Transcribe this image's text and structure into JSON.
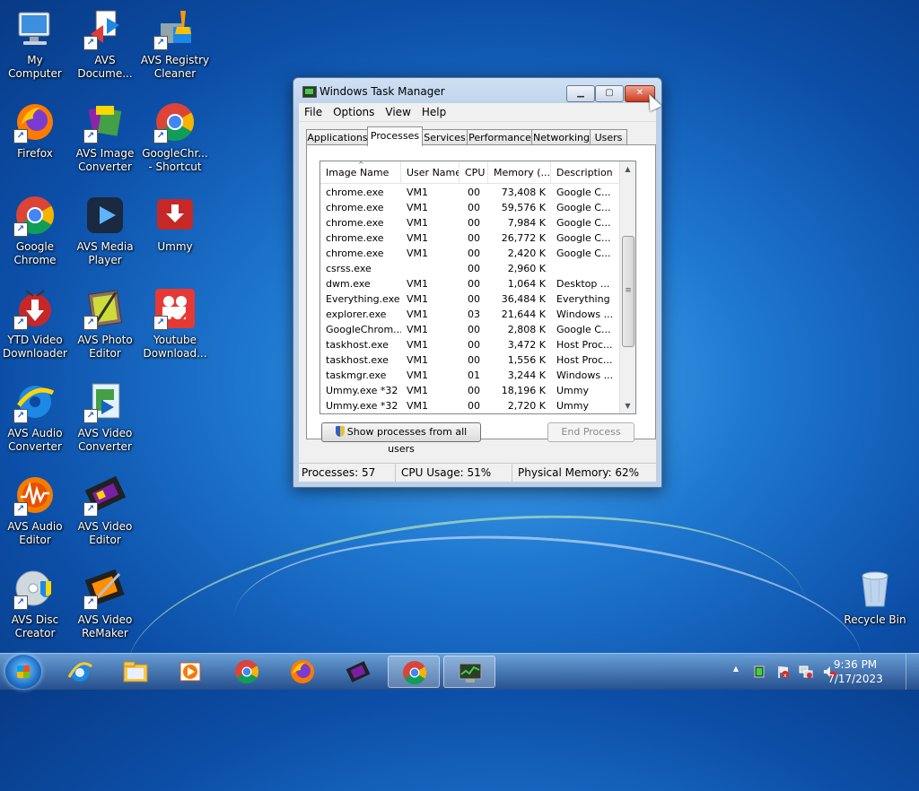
{
  "desktop": {
    "icons": [
      {
        "label": "My Computer",
        "icon": "computer-icon"
      },
      {
        "label": "AVS Docume...",
        "icon": "avs-document-converter-icon"
      },
      {
        "label": "AVS Registry Cleaner",
        "icon": "avs-registry-cleaner-icon"
      },
      {
        "label": "Firefox",
        "icon": "firefox-icon"
      },
      {
        "label": "AVS Image Converter",
        "icon": "avs-image-converter-icon"
      },
      {
        "label": "GoogleChr... - Shortcut",
        "icon": "chrome-icon"
      },
      {
        "label": "Google Chrome",
        "icon": "chrome-icon"
      },
      {
        "label": "AVS Media Player",
        "icon": "avs-media-player-icon"
      },
      {
        "label": "Ummy",
        "icon": "ummy-icon"
      },
      {
        "label": "YTD Video Downloader",
        "icon": "ytd-downloader-icon"
      },
      {
        "label": "AVS Photo Editor",
        "icon": "avs-photo-editor-icon"
      },
      {
        "label": "Youtube Download...",
        "icon": "youtube-downloader-icon"
      },
      {
        "label": "AVS Audio Converter",
        "icon": "avs-audio-converter-icon"
      },
      {
        "label": "AVS Video Converter",
        "icon": "avs-video-converter-icon"
      },
      {
        "label": "AVS Audio Editor",
        "icon": "avs-audio-editor-icon"
      },
      {
        "label": "AVS Video Editor",
        "icon": "avs-video-editor-icon"
      },
      {
        "label": "AVS Disc Creator",
        "icon": "avs-disc-creator-icon"
      },
      {
        "label": "AVS Video ReMaker",
        "icon": "avs-video-remaker-icon"
      },
      {
        "label": "Recycle Bin",
        "icon": "recycle-bin-icon"
      }
    ]
  },
  "window": {
    "title": "Windows Task Manager",
    "minimize_glyph": "▁",
    "maximize_glyph": "▢",
    "close_glyph": "✕",
    "menu": [
      "File",
      "Options",
      "View",
      "Help"
    ],
    "tabs": [
      "Applications",
      "Processes",
      "Services",
      "Performance",
      "Networking",
      "Users"
    ],
    "active_tab": "Processes",
    "columns": [
      "Image Name",
      "User Name",
      "CPU",
      "Memory (...",
      "Description"
    ],
    "sort_glyph": "^",
    "processes": [
      {
        "name": "chrome.exe",
        "user": "VM1",
        "cpu": "00",
        "memory": "73,408 K",
        "desc": "Google C..."
      },
      {
        "name": "chrome.exe",
        "user": "VM1",
        "cpu": "00",
        "memory": "59,576 K",
        "desc": "Google C..."
      },
      {
        "name": "chrome.exe",
        "user": "VM1",
        "cpu": "00",
        "memory": "7,984 K",
        "desc": "Google C..."
      },
      {
        "name": "chrome.exe",
        "user": "VM1",
        "cpu": "00",
        "memory": "26,772 K",
        "desc": "Google C..."
      },
      {
        "name": "chrome.exe",
        "user": "VM1",
        "cpu": "00",
        "memory": "2,420 K",
        "desc": "Google C..."
      },
      {
        "name": "csrss.exe",
        "user": "",
        "cpu": "00",
        "memory": "2,960 K",
        "desc": ""
      },
      {
        "name": "dwm.exe",
        "user": "VM1",
        "cpu": "00",
        "memory": "1,064 K",
        "desc": "Desktop ..."
      },
      {
        "name": "Everything.exe",
        "user": "VM1",
        "cpu": "00",
        "memory": "36,484 K",
        "desc": "Everything"
      },
      {
        "name": "explorer.exe",
        "user": "VM1",
        "cpu": "03",
        "memory": "21,644 K",
        "desc": "Windows ..."
      },
      {
        "name": "GoogleChrom...",
        "user": "VM1",
        "cpu": "00",
        "memory": "2,808 K",
        "desc": "Google C..."
      },
      {
        "name": "taskhost.exe",
        "user": "VM1",
        "cpu": "00",
        "memory": "3,472 K",
        "desc": "Host Proc..."
      },
      {
        "name": "taskhost.exe",
        "user": "VM1",
        "cpu": "00",
        "memory": "1,556 K",
        "desc": "Host Proc..."
      },
      {
        "name": "taskmgr.exe",
        "user": "VM1",
        "cpu": "01",
        "memory": "3,244 K",
        "desc": "Windows ..."
      },
      {
        "name": "Ummy.exe *32",
        "user": "VM1",
        "cpu": "00",
        "memory": "18,196 K",
        "desc": "Ummy"
      },
      {
        "name": "Ummy.exe *32",
        "user": "VM1",
        "cpu": "00",
        "memory": "2,720 K",
        "desc": "Ummy"
      }
    ],
    "scroll_up_glyph": "▲",
    "scroll_down_glyph": "▼",
    "scroll_grip_glyph": "≡",
    "show_all_button": "Show processes from all users",
    "end_process_button": "End Process",
    "status": {
      "processes": "Processes: 57",
      "cpu": "CPU Usage: 51%",
      "memory": "Physical Memory: 62%"
    }
  },
  "taskbar": {
    "buttons": [
      {
        "icon": "internet-explorer-icon"
      },
      {
        "icon": "file-explorer-icon"
      },
      {
        "icon": "media-player-icon"
      },
      {
        "icon": "chrome-icon"
      },
      {
        "icon": "firefox-icon"
      },
      {
        "icon": "avs-video-editor-icon"
      },
      {
        "icon": "chrome-icon"
      },
      {
        "icon": "task-manager-icon"
      }
    ],
    "tray_expand_glyph": "▲",
    "clock_time": "9:36 PM",
    "clock_date": "7/17/2023"
  },
  "colors": {
    "desktop_blue": "#1f78d0",
    "close_red": "#cc3a1d",
    "selection_blue": "#3399ff"
  }
}
